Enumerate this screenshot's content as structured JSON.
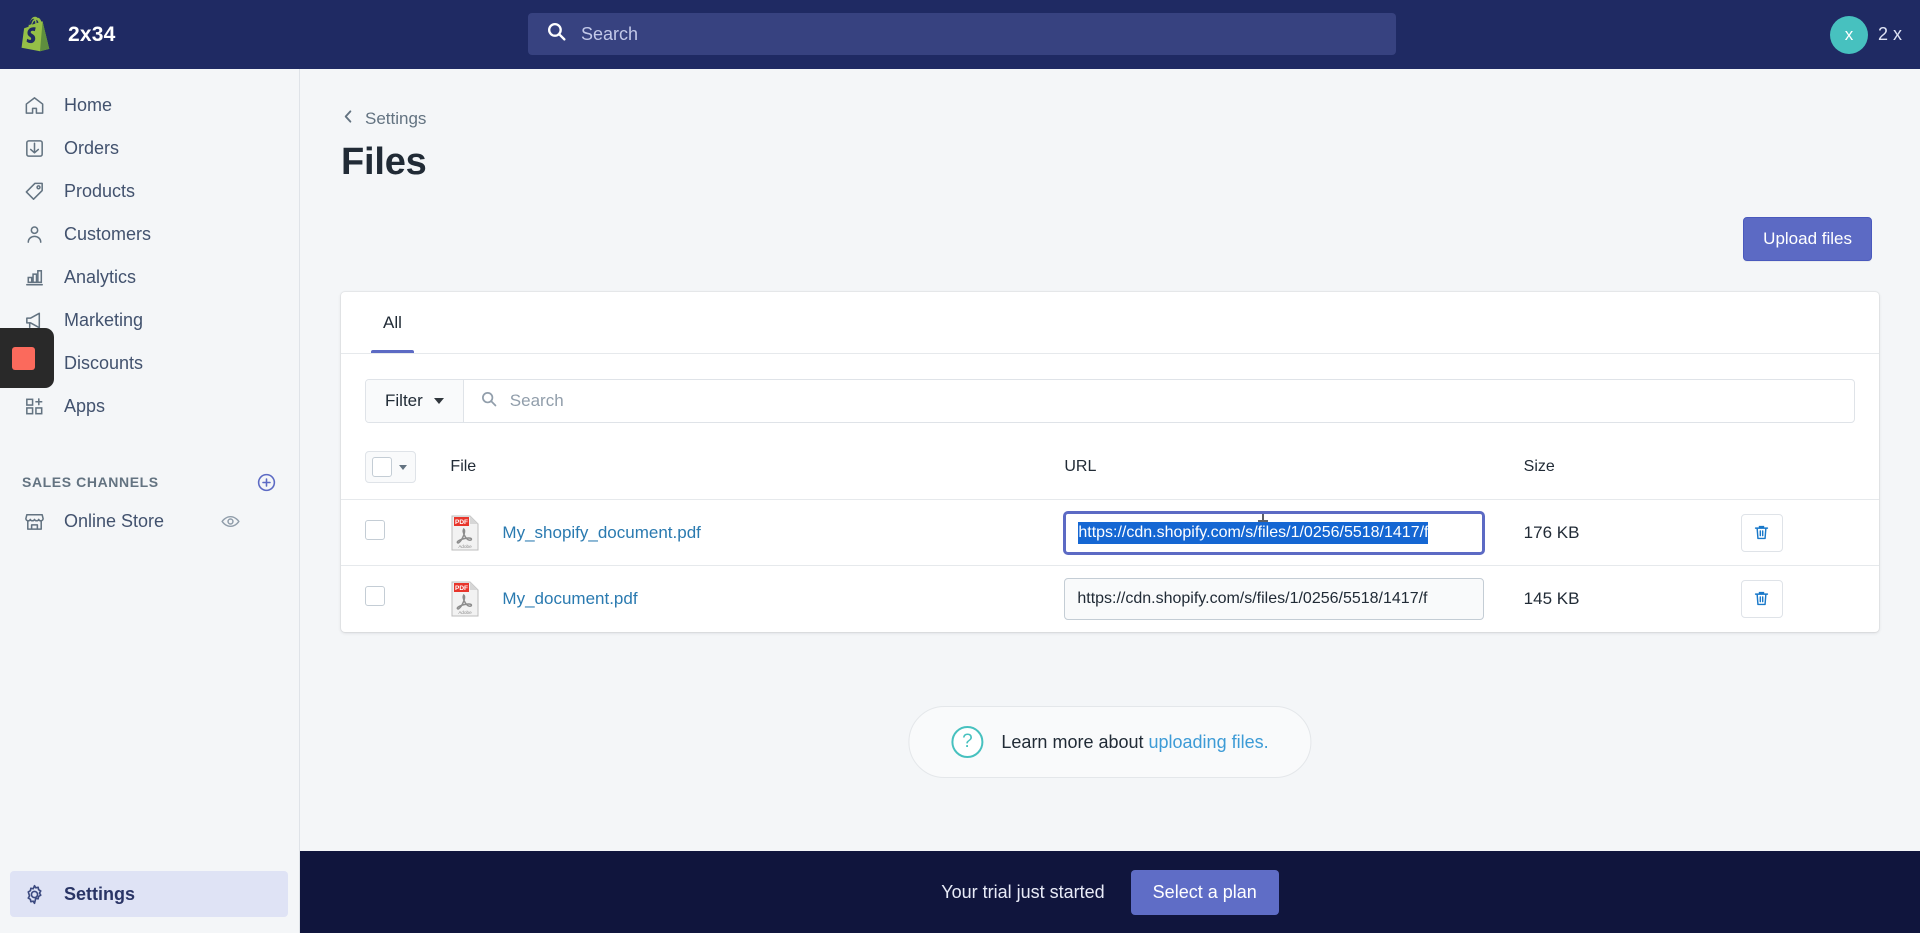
{
  "topbar": {
    "store_name": "2x34",
    "logo_icon": "shopify-bag-icon",
    "search": {
      "icon": "search-icon",
      "placeholder": "Search",
      "value": ""
    },
    "user": {
      "avatar_initial": "x",
      "name": "2 x"
    }
  },
  "sidebar": {
    "items": [
      {
        "label": "Home",
        "icon": "home-icon"
      },
      {
        "label": "Orders",
        "icon": "orders-inbox-icon"
      },
      {
        "label": "Products",
        "icon": "tag-icon"
      },
      {
        "label": "Customers",
        "icon": "person-icon"
      },
      {
        "label": "Analytics",
        "icon": "bar-chart-icon"
      },
      {
        "label": "Marketing",
        "icon": "megaphone-icon"
      },
      {
        "label": "Discounts",
        "icon": "discount-icon"
      },
      {
        "label": "Apps",
        "icon": "apps-grid-plus-icon"
      }
    ],
    "section": {
      "title": "SALES CHANNELS",
      "add_icon": "circle-plus-icon",
      "channels": [
        {
          "label": "Online Store",
          "icon": "storefront-icon",
          "action_icon": "eye-icon"
        }
      ]
    },
    "settings": {
      "label": "Settings",
      "icon": "gear-icon"
    },
    "recording_chip": {
      "icon": "stop-recording-icon",
      "color": "#fb6a5c"
    }
  },
  "main": {
    "breadcrumb": {
      "icon": "chevron-left-icon",
      "label": "Settings"
    },
    "page_title": "Files",
    "upload_button": "Upload files",
    "tabs": [
      {
        "label": "All",
        "active": true
      }
    ],
    "filter": {
      "button_label": "Filter",
      "caret_icon": "chevron-down-icon",
      "search_icon": "search-icon",
      "search_placeholder": "Search",
      "search_value": ""
    },
    "table": {
      "select_all": {
        "checkbox_icon": "checkbox-unchecked-icon",
        "caret_icon": "chevron-down-icon"
      },
      "columns": [
        "File",
        "URL",
        "Size"
      ],
      "rows": [
        {
          "checked": false,
          "file_icon": "pdf-file-icon",
          "file_name": "My_shopify_document.pdf",
          "url": "https://cdn.shopify.com/s/files/1/0256/5518/1417/f",
          "url_selected": true,
          "url_focused": true,
          "size": "176 KB",
          "delete_icon": "trash-icon"
        },
        {
          "checked": false,
          "file_icon": "pdf-file-icon",
          "file_name": "My_document.pdf",
          "url": "https://cdn.shopify.com/s/files/1/0256/5518/1417/f",
          "url_selected": false,
          "url_focused": false,
          "size": "145 KB",
          "delete_icon": "trash-icon"
        }
      ]
    },
    "help": {
      "icon": "question-circle-icon",
      "text_before": "Learn more about ",
      "link": "uploading files."
    }
  },
  "trial_banner": {
    "message": "Your trial just started",
    "button_label": "Select a plan"
  },
  "colors": {
    "topbar_bg": "#1f2a63",
    "accent_indigo": "#5c6ac4",
    "avatar_teal": "#47c1bf",
    "link_blue": "#2a7ab0",
    "selection_blue": "#1567d3",
    "trial_bg": "#10153d",
    "recording_red": "#fb6a5c"
  }
}
